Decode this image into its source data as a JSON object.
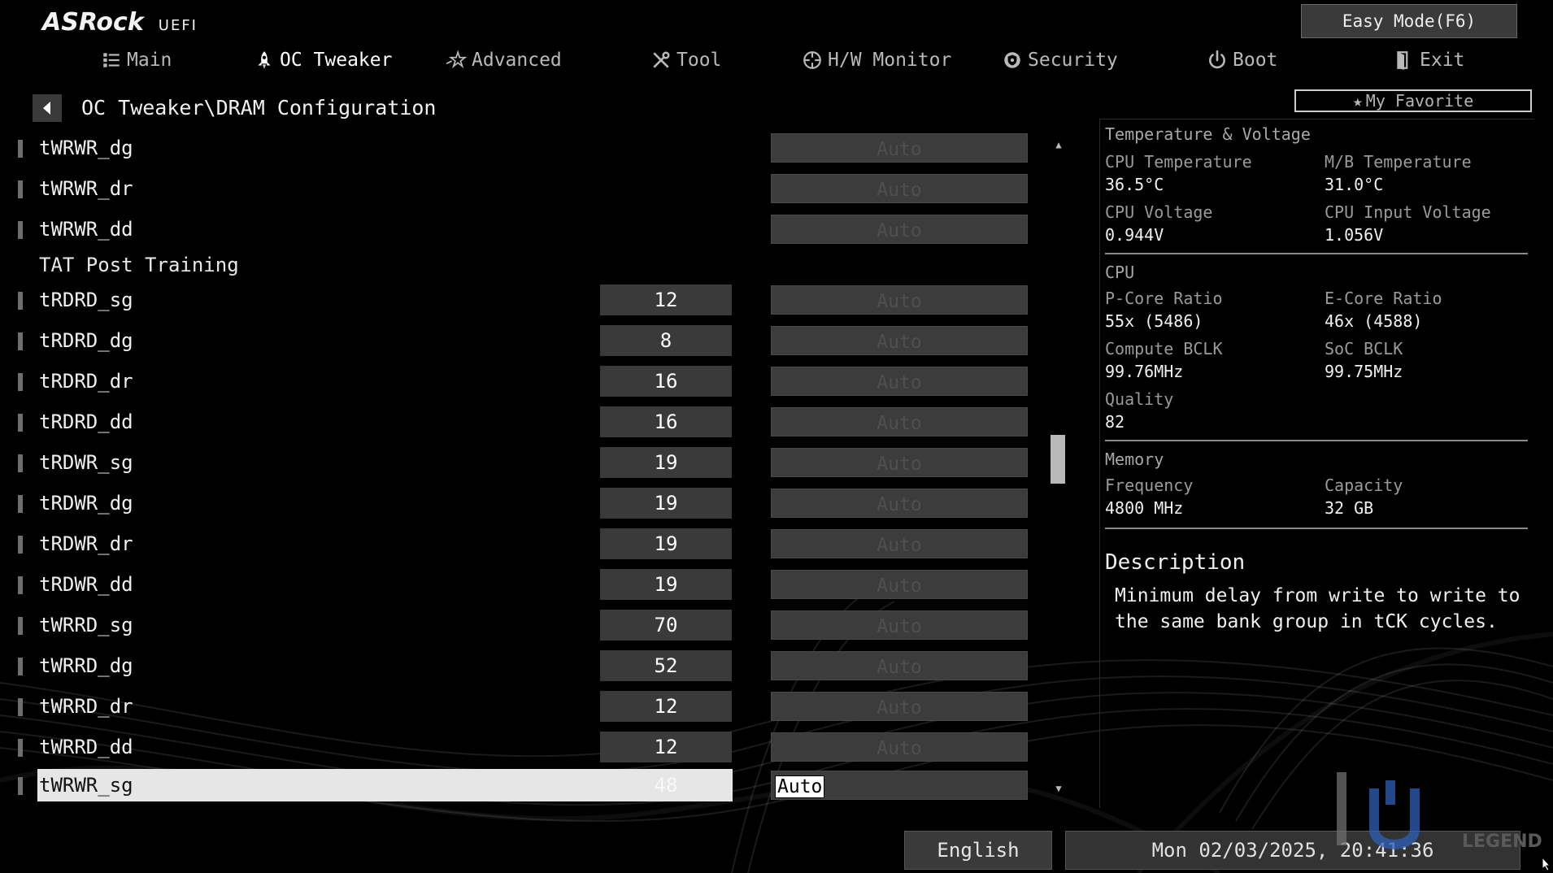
{
  "header": {
    "brand": "ASRock",
    "subtitle": "UEFI",
    "easy_mode": "Easy Mode(F6)"
  },
  "nav": {
    "tabs": [
      {
        "label": "Main",
        "icon": "list-icon"
      },
      {
        "label": "OC Tweaker",
        "icon": "rocket-icon",
        "active": true
      },
      {
        "label": "Advanced",
        "icon": "star-icon"
      },
      {
        "label": "Tool",
        "icon": "tools-icon"
      },
      {
        "label": "H/W Monitor",
        "icon": "monitor-icon"
      },
      {
        "label": "Security",
        "icon": "shield-icon"
      },
      {
        "label": "Boot",
        "icon": "power-icon"
      },
      {
        "label": "Exit",
        "icon": "exit-icon"
      }
    ]
  },
  "breadcrumb": "OC Tweaker\\DRAM Configuration",
  "favorite": "My Favorite",
  "settings": [
    {
      "label": "tWRWR_dg",
      "current": "",
      "option": "Auto"
    },
    {
      "label": "tWRWR_dr",
      "current": "",
      "option": "Auto"
    },
    {
      "label": "tWRWR_dd",
      "current": "",
      "option": "Auto"
    },
    {
      "label": "TAT Post Training",
      "section": true
    },
    {
      "label": "tRDRD_sg",
      "current": "12",
      "option": "Auto"
    },
    {
      "label": "tRDRD_dg",
      "current": "8",
      "option": "Auto"
    },
    {
      "label": "tRDRD_dr",
      "current": "16",
      "option": "Auto"
    },
    {
      "label": "tRDRD_dd",
      "current": "16",
      "option": "Auto"
    },
    {
      "label": "tRDWR_sg",
      "current": "19",
      "option": "Auto"
    },
    {
      "label": "tRDWR_dg",
      "current": "19",
      "option": "Auto"
    },
    {
      "label": "tRDWR_dr",
      "current": "19",
      "option": "Auto"
    },
    {
      "label": "tRDWR_dd",
      "current": "19",
      "option": "Auto"
    },
    {
      "label": "tWRRD_sg",
      "current": "70",
      "option": "Auto"
    },
    {
      "label": "tWRRD_dg",
      "current": "52",
      "option": "Auto"
    },
    {
      "label": "tWRRD_dr",
      "current": "12",
      "option": "Auto"
    },
    {
      "label": "tWRRD_dd",
      "current": "12",
      "option": "Auto"
    },
    {
      "label": "tWRWR_sg",
      "current": "48",
      "option": "Auto",
      "selected": true
    }
  ],
  "panel": {
    "temp_voltage": {
      "title": "Temperature & Voltage",
      "cpu_temp_label": "CPU Temperature",
      "cpu_temp": "36.5°C",
      "mb_temp_label": "M/B Temperature",
      "mb_temp": "31.0°C",
      "cpu_volt_label": "CPU Voltage",
      "cpu_volt": "0.944V",
      "cpu_input_label": "CPU Input Voltage",
      "cpu_input": "1.056V"
    },
    "cpu": {
      "title": "CPU",
      "pcore_label": "P-Core Ratio",
      "pcore": "55x (5486)",
      "ecore_label": "E-Core Ratio",
      "ecore": "46x (4588)",
      "bclk_label": "Compute BCLK",
      "bclk": "99.76MHz",
      "soc_label": "SoC BCLK",
      "soc": "99.75MHz",
      "quality_label": "Quality",
      "quality": "82"
    },
    "memory": {
      "title": "Memory",
      "freq_label": "Frequency",
      "freq": "4800 MHz",
      "cap_label": "Capacity",
      "cap": "32 GB"
    },
    "description": {
      "title": "Description",
      "text": "Minimum delay from write to write to the same bank group in tCK cycles."
    }
  },
  "footer": {
    "language": "English",
    "datetime": "Mon 02/03/2025, 20:41:36"
  },
  "scroll": {
    "position_fraction": 0.45
  },
  "watermark": {
    "text": "LEGEND"
  },
  "colors": {
    "background": "#000000",
    "option_box": "#3c3c3c",
    "highlight": "#e6e6e6"
  }
}
